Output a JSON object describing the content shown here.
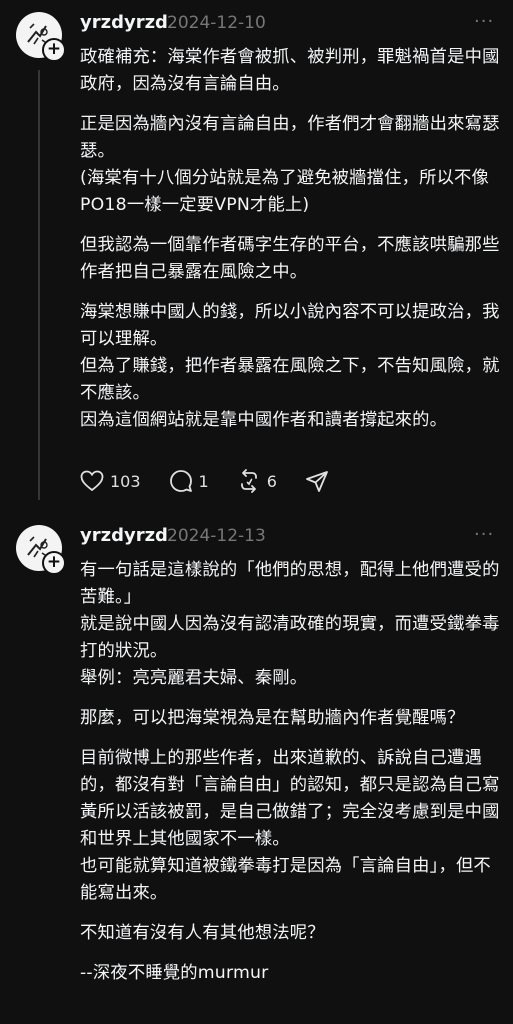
{
  "posts": [
    {
      "username": "yrzdyrzd",
      "date": "2024-12-10",
      "more": "···",
      "paragraphs": [
        "政確補充：海棠作者會被抓、被判刑，罪魁禍首是中國政府，因為沒有言論自由。",
        "正是因為牆內沒有言論自由，作者們才會翻牆出來寫瑟瑟。\n(海棠有十八個分站就是為了避免被牆擋住，所以不像PO18一樣一定要VPN才能上)",
        "但我認為一個靠作者碼字生存的平台，不應該哄騙那些作者把自己暴露在風險之中。",
        "海棠想賺中國人的錢，所以小說內容不可以提政治，我可以理解。\n但為了賺錢，把作者暴露在風險之下，不告知風險，就不應該。\n因為這個網站就是靠中國作者和讀者撐起來的。"
      ],
      "likes": "103",
      "replies": "1",
      "reposts": "6"
    },
    {
      "username": "yrzdyrzd",
      "date": "2024-12-13",
      "more": "···",
      "paragraphs": [
        "有一句話是這樣說的「他們的思想，配得上他們遭受的苦難。」\n就是說中國人因為沒有認清政確的現實，而遭受鐵拳毒打的狀況。\n舉例：亮亮麗君夫婦、秦剛。",
        "那麼，可以把海棠視為是在幫助牆內作者覺醒嗎？",
        "目前微博上的那些作者，出來道歉的、訴說自己遭遇的，都沒有對「言論自由」的認知，都只是認為自己寫黃所以活該被罰，是自己做錯了；完全沒考慮到是中國和世界上其他國家不一樣。\n也可能就算知道被鐵拳毒打是因為「言論自由」，但不能寫出來。",
        "不知道有沒有人有其他想法呢？",
        "--深夜不睡覺的murmur"
      ]
    }
  ],
  "colors": {
    "background": "#101010",
    "text": "#f3f5f7",
    "secondary": "#777777",
    "thread_line": "#333638"
  },
  "icons": [
    "more-icon",
    "heart-icon",
    "comment-icon",
    "repost-icon",
    "share-icon",
    "follow-plus-icon"
  ]
}
